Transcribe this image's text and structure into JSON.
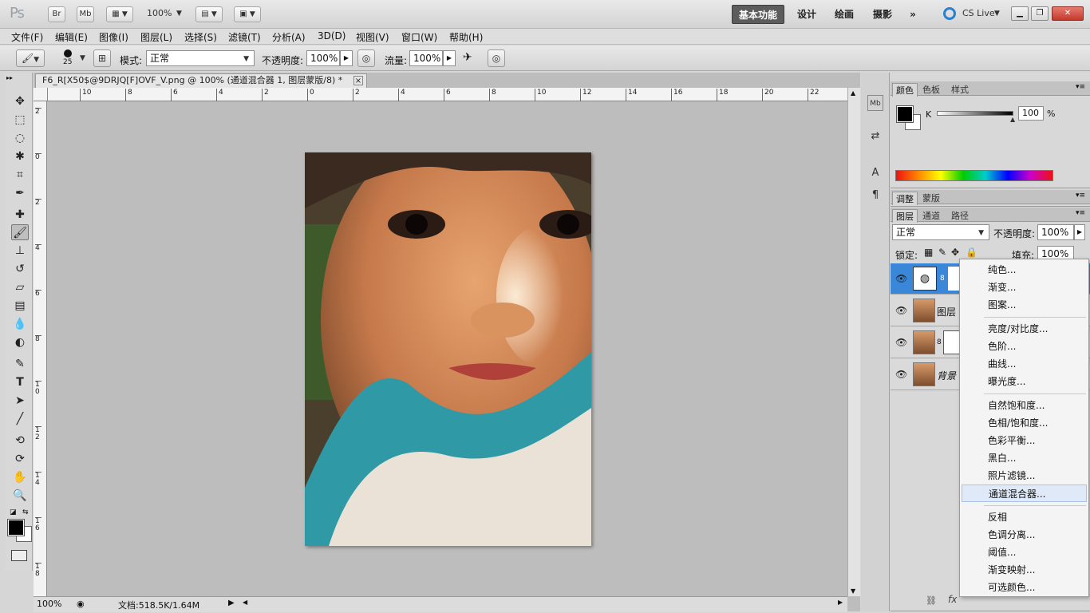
{
  "titlebar": {
    "app_logo": "Ps",
    "bridge_label": "Br",
    "minibridge_label": "Mb",
    "zoom": "100%",
    "workspaces": [
      "基本功能",
      "设计",
      "绘画",
      "摄影"
    ],
    "more": "»",
    "cs_live": "CS Live"
  },
  "menu": [
    "文件(F)",
    "编辑(E)",
    "图像(I)",
    "图层(L)",
    "选择(S)",
    "滤镜(T)",
    "分析(A)",
    "3D(D)",
    "视图(V)",
    "窗口(W)",
    "帮助(H)"
  ],
  "options": {
    "brush_size": "25",
    "mode_label": "模式:",
    "mode_value": "正常",
    "opacity_label": "不透明度:",
    "opacity_value": "100%",
    "flow_label": "流量:",
    "flow_value": "100%"
  },
  "document": {
    "tab_title": "F6_R[X50$@9DRJQ[F]OVF_V.png @ 100% (通道混合器 1, 图层蒙版/8) *",
    "close": "×",
    "status_zoom": "100%",
    "status_doc": "文档:518.5K/1.64M"
  },
  "ruler_h": [
    "10",
    "8",
    "6",
    "4",
    "2",
    "0",
    "2",
    "4",
    "6",
    "8",
    "10",
    "12",
    "14",
    "16",
    "18",
    "20",
    "22"
  ],
  "ruler_v": [
    "2",
    "0",
    "2",
    "4",
    "6",
    "8",
    "1 0",
    "1 2",
    "1 4",
    "1 6",
    "1 8"
  ],
  "color_panel": {
    "tabs": [
      "颜色",
      "色板",
      "样式"
    ],
    "channel_label": "K",
    "value": "100",
    "unit": "%"
  },
  "adjust_panel": {
    "tabs": [
      "调整",
      "蒙版"
    ]
  },
  "layers_panel": {
    "tabs": [
      "图层",
      "通道",
      "路径"
    ],
    "blend_mode": "正常",
    "opacity_label": "不透明度:",
    "opacity_value": "100%",
    "lock_label": "锁定:",
    "fill_label": "填充:",
    "fill_value": "100%",
    "layers": [
      {
        "name": ""
      },
      {
        "name": "图层"
      },
      {
        "name": ""
      },
      {
        "name": "背景"
      }
    ]
  },
  "adjust_menu": {
    "group1": [
      "纯色...",
      "渐变...",
      "图案..."
    ],
    "group2": [
      "亮度/对比度...",
      "色阶...",
      "曲线...",
      "曝光度..."
    ],
    "group3": [
      "自然饱和度...",
      "色相/饱和度...",
      "色彩平衡...",
      "黑白...",
      "照片滤镜...",
      "通道混合器..."
    ],
    "group4": [
      "反相",
      "色调分离...",
      "阈值...",
      "渐变映射...",
      "可选颜色..."
    ],
    "highlighted": "通道混合器..."
  },
  "colors": {
    "accent_highlight": "#dfe9f7",
    "layer_selected": "#3a86d8",
    "panel_bg": "#d8d8d8",
    "canvas_bg": "#bdbdbd"
  }
}
